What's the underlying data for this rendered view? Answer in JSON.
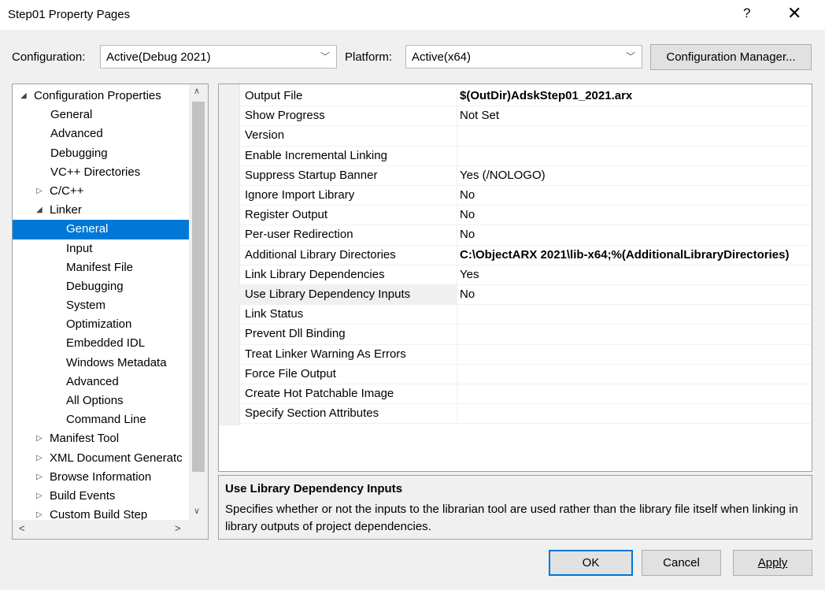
{
  "window": {
    "title": "Step01 Property Pages",
    "help": "?",
    "close": "✕"
  },
  "config": {
    "configuration_label": "Configuration:",
    "configuration_value": "Active(Debug 2021)",
    "platform_label": "Platform:",
    "platform_value": "Active(x64)",
    "manager_button": "Configuration Manager..."
  },
  "tree": [
    {
      "label": "Configuration Properties",
      "level": 0,
      "expander": "◢"
    },
    {
      "label": "General",
      "level": 1
    },
    {
      "label": "Advanced",
      "level": 1
    },
    {
      "label": "Debugging",
      "level": 1
    },
    {
      "label": "VC++ Directories",
      "level": 1
    },
    {
      "label": "C/C++",
      "level": 1,
      "expander": "▷"
    },
    {
      "label": "Linker",
      "level": 1,
      "expander": "◢"
    },
    {
      "label": "General",
      "level": 2,
      "selected": true
    },
    {
      "label": "Input",
      "level": 2
    },
    {
      "label": "Manifest File",
      "level": 2
    },
    {
      "label": "Debugging",
      "level": 2
    },
    {
      "label": "System",
      "level": 2
    },
    {
      "label": "Optimization",
      "level": 2
    },
    {
      "label": "Embedded IDL",
      "level": 2
    },
    {
      "label": "Windows Metadata",
      "level": 2
    },
    {
      "label": "Advanced",
      "level": 2
    },
    {
      "label": "All Options",
      "level": 2
    },
    {
      "label": "Command Line",
      "level": 2
    },
    {
      "label": "Manifest Tool",
      "level": 1,
      "expander": "▷"
    },
    {
      "label": "XML Document Generatc",
      "level": 1,
      "expander": "▷"
    },
    {
      "label": "Browse Information",
      "level": 1,
      "expander": "▷"
    },
    {
      "label": "Build Events",
      "level": 1,
      "expander": "▷"
    },
    {
      "label": "Custom Build Step",
      "level": 1,
      "expander": "▷"
    }
  ],
  "properties": [
    {
      "name": "Output File",
      "value": "$(OutDir)AdskStep01_2021.arx",
      "bold": true
    },
    {
      "name": "Show Progress",
      "value": "Not Set"
    },
    {
      "name": "Version",
      "value": ""
    },
    {
      "name": "Enable Incremental Linking",
      "value": ""
    },
    {
      "name": "Suppress Startup Banner",
      "value": "Yes (/NOLOGO)"
    },
    {
      "name": "Ignore Import Library",
      "value": "No"
    },
    {
      "name": "Register Output",
      "value": "No"
    },
    {
      "name": "Per-user Redirection",
      "value": "No"
    },
    {
      "name": "Additional Library Directories",
      "value": "C:\\ObjectARX 2021\\lib-x64;%(AdditionalLibraryDirectories)",
      "bold": true
    },
    {
      "name": "Link Library Dependencies",
      "value": "Yes"
    },
    {
      "name": "Use Library Dependency Inputs",
      "value": "No",
      "selected": true
    },
    {
      "name": "Link Status",
      "value": ""
    },
    {
      "name": "Prevent Dll Binding",
      "value": ""
    },
    {
      "name": "Treat Linker Warning As Errors",
      "value": ""
    },
    {
      "name": "Force File Output",
      "value": ""
    },
    {
      "name": "Create Hot Patchable Image",
      "value": ""
    },
    {
      "name": "Specify Section Attributes",
      "value": ""
    }
  ],
  "description": {
    "title": "Use Library Dependency Inputs",
    "text": "Specifies whether or not the inputs to the librarian tool are used rather than the library file itself when linking in library outputs of project dependencies."
  },
  "buttons": {
    "ok": "OK",
    "cancel": "Cancel",
    "apply": "Apply"
  },
  "scroll": {
    "up": "∧",
    "down": "∨",
    "left": "<",
    "right": ">"
  }
}
